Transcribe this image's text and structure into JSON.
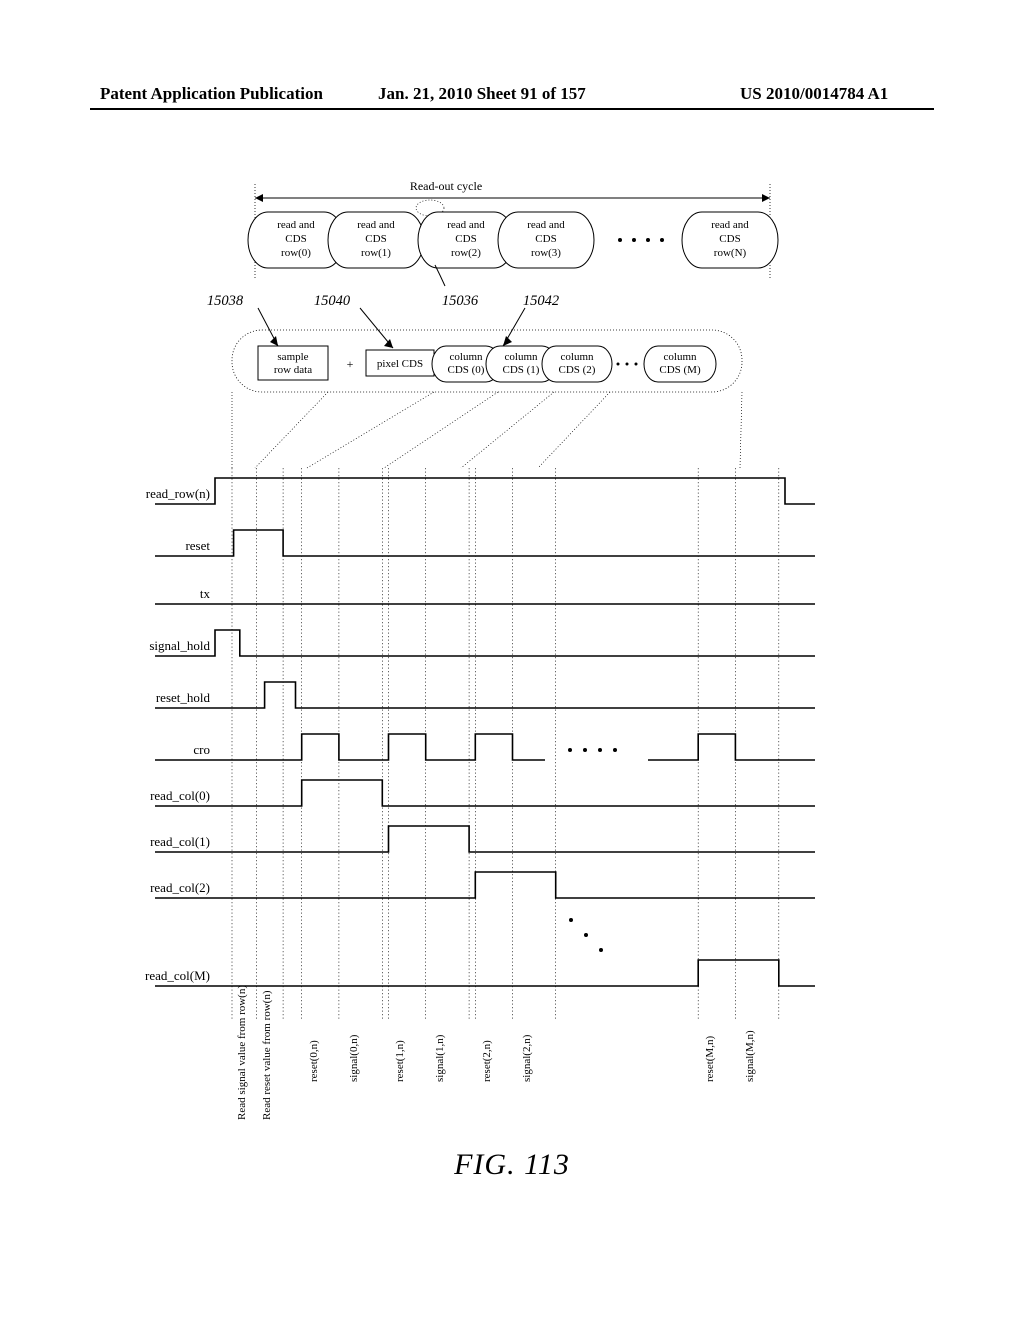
{
  "header": {
    "left": "Patent Application Publication",
    "mid": "Jan. 21, 2010  Sheet 91 of 157",
    "right": "US 2010/0014784 A1"
  },
  "fig_caption": "FIG. 113",
  "top_label": "Read-out cycle",
  "cycle_boxes": [
    {
      "l1": "read and",
      "l2": "CDS",
      "l3": "row(0)"
    },
    {
      "l1": "read and",
      "l2": "CDS",
      "l3": "row(1)"
    },
    {
      "l1": "read and",
      "l2": "CDS",
      "l3": "row(2)"
    },
    {
      "l1": "read and",
      "l2": "CDS",
      "l3": "row(3)"
    },
    {
      "l1": "read and",
      "l2": "CDS",
      "l3": "row(N)"
    }
  ],
  "refs": {
    "a": "15038",
    "b": "15040",
    "c": "15036",
    "d": "15042"
  },
  "detail_boxes": {
    "sample": {
      "l1": "sample",
      "l2": "row data"
    },
    "plus": "+",
    "pixel": "pixel CDS",
    "cols": [
      "column CDS (0)",
      "column CDS (1)",
      "column CDS (2)",
      "column CDS (M)"
    ]
  },
  "signals": [
    "read_row(n)",
    "reset",
    "tx",
    "signal_hold",
    "reset_hold",
    "cro",
    "read_col(0)",
    "read_col(1)",
    "read_col(2)",
    "read_col(M)"
  ],
  "vlabels": {
    "read_sig": "Read signal value from row(n)",
    "read_rst": "Read reset value from row(n)",
    "rst0": "reset(0,n)",
    "sig0": "signal(0,n)",
    "rst1": "reset(1,n)",
    "sig1": "signal(1,n)",
    "rst2": "reset(2,n)",
    "sig2": "signal(2,n)",
    "rstM": "reset(M,n)",
    "sigM": "signal(M,n)"
  },
  "chart_data": {
    "type": "timing-diagram",
    "title": "Read-out cycle timing",
    "signals": [
      {
        "name": "read_row(n)",
        "high_intervals": [
          [
            0,
            46
          ]
        ]
      },
      {
        "name": "reset",
        "high_intervals": [
          [
            1.5,
            5.5
          ]
        ]
      },
      {
        "name": "tx",
        "high_intervals": []
      },
      {
        "name": "signal_hold",
        "high_intervals": [
          [
            0,
            2
          ]
        ]
      },
      {
        "name": "reset_hold",
        "high_intervals": [
          [
            4,
            6.5
          ]
        ]
      },
      {
        "name": "cro",
        "high_intervals": [
          [
            7,
            10
          ],
          [
            14,
            17
          ],
          [
            21,
            24
          ],
          [
            28,
            31
          ],
          [
            39,
            42
          ]
        ]
      },
      {
        "name": "read_col(0)",
        "high_intervals": [
          [
            7,
            13.5
          ]
        ]
      },
      {
        "name": "read_col(1)",
        "high_intervals": [
          [
            14,
            20.5
          ]
        ]
      },
      {
        "name": "read_col(2)",
        "high_intervals": [
          [
            21,
            27.5
          ]
        ]
      },
      {
        "name": "read_col(M)",
        "high_intervals": [
          [
            39,
            45.5
          ]
        ]
      }
    ],
    "time_units": 46,
    "annotations": [
      "Read signal value from row(n)",
      "Read reset value from row(n)",
      "reset(0,n)",
      "signal(0,n)",
      "reset(1,n)",
      "signal(1,n)",
      "reset(2,n)",
      "signal(2,n)",
      "reset(M,n)",
      "signal(M,n)"
    ]
  }
}
